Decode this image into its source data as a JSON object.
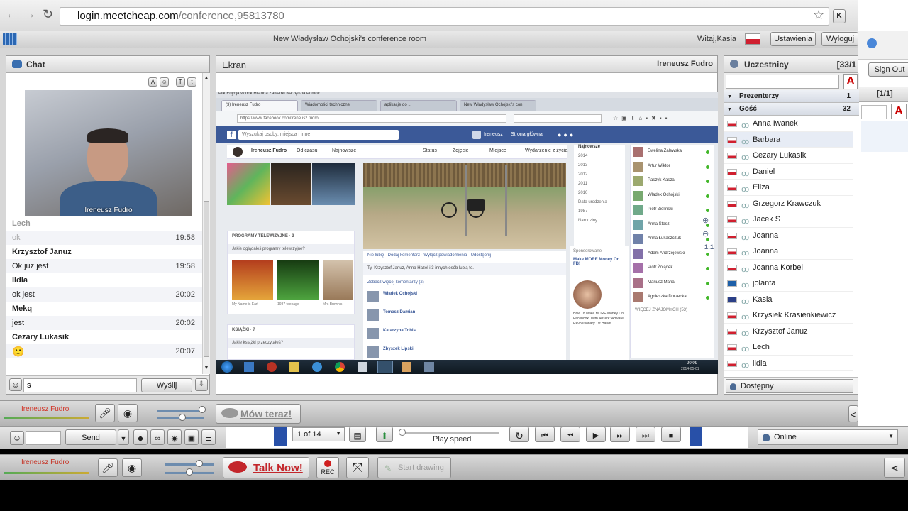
{
  "browser": {
    "url_domain": "login.meetcheap.com",
    "url_path": "/conference,95813780",
    "star_icon": "☆",
    "ext_label": "K"
  },
  "app": {
    "room_title": "New Władysław Ochojski's conference room",
    "greeting": "Witaj,Kasia",
    "settings_button": "Ustawienia",
    "logout_button": "Wyloguj s",
    "outer_signout": "Sign Out",
    "outer_page": "[1/1]"
  },
  "chat": {
    "title": "Chat",
    "video_label": "Ireneusz Fudro",
    "messages": [
      {
        "author": "Lech",
        "text": "ok",
        "time": "19:58",
        "faded": true
      },
      {
        "author": "Krzysztof Januz",
        "text": "Ok już jest",
        "time": "19:58"
      },
      {
        "author": "lidia",
        "text": "ok jest",
        "time": "20:02"
      },
      {
        "author": "Mekq",
        "text": "jest",
        "time": "20:02"
      },
      {
        "author": "Cezary Lukasik",
        "text": "🙂",
        "time": "20:07"
      }
    ],
    "input_value": "s",
    "send_button": "Wyślij"
  },
  "screen_panel": {
    "title": "Ekran",
    "presenter": "Ireneusz Fudro",
    "shared": {
      "tabs": [
        "(3) Ireneusz Fudro",
        "Wiadomości techniczne",
        "aplikacje do ..",
        "New Władysław Ochojski's con"
      ],
      "url": "https://www.facebook.com/Ireneusz.fudro",
      "fb_search": "Wyszukaj osoby, miejsca i inne",
      "fb_user": "Ireneusz",
      "fb_home": "Strona główna",
      "profile_name": "Ireneusz Fudro",
      "profile_links": [
        "Od czasu",
        "Najnowsze"
      ],
      "post_actions": [
        "Status",
        "Zdjęcie",
        "Miejsce",
        "Wydarzenie z życia"
      ],
      "years": [
        "Najnowsze",
        "2014",
        "2013",
        "2012",
        "2011",
        "2010",
        "Data urodzenia",
        "1987",
        "Narodziny"
      ],
      "section_tv": "PROGRAMY TELEWIZYJNE · 3",
      "tv_question": "Jakie oglądałeś programy telewizyjne?",
      "tv_items": [
        "My Name is Earl",
        "1987 teenage",
        "Mrs Brown's"
      ],
      "section_books": "KSIĄŻKI · 7",
      "books_question": "Jakie książki przeczytałeś?",
      "post_actions_bar": "Nie lubię · Dodaj komentarz · Wyłącz powiadomienia · Udostępnij",
      "likes_line": "Ty, Krzysztof Januz, Anna Hazel i 3 innych osób lubią to.",
      "more_comments": "Zobacz więcej komentarzy (2)",
      "commenters": [
        "Władek Ochojski",
        "Tomasz Damian",
        "Katarzyna Tobis",
        "Zbyszek Lipski"
      ],
      "sponsored": "Sponsorowane",
      "ad_title": "Make MORE Money On FB!",
      "ad_text": "How To Make MORE Money On Facebook! With Adzerk: Adware. Revolutionary 1st Hand!",
      "friends": [
        "Ewelina Zalewska",
        "Artur Wiktor",
        "Paszyk Kasza",
        "Władek Ochojski",
        "Piotr Zielinski",
        "Anna Stasz",
        "Anna Łukaszczuk",
        "Adam Andrzejewski",
        "Piotr Żołądek",
        "Mariusz Maria",
        "Agnieszka Dorzecka"
      ],
      "more_contacts": "WIĘCEJ ZNAJOMYCH (53)",
      "taskbar_time": "20:09",
      "taskbar_date": "2014-05-01"
    }
  },
  "participants": {
    "title": "Uczestnicy",
    "count": "[33/1",
    "group_presenters": "Prezenterzy",
    "group_presenters_count": "1",
    "group_guests": "Gość",
    "group_guests_count": "32",
    "people": [
      {
        "name": "Anna Iwanek",
        "flag": "pl"
      },
      {
        "name": "Barbara",
        "flag": "pl"
      },
      {
        "name": "Cezary Lukasik",
        "flag": "pl"
      },
      {
        "name": "Daniel",
        "flag": "pl"
      },
      {
        "name": "Eliza",
        "flag": "pl"
      },
      {
        "name": "Grzegorz Krawczuk",
        "flag": "pl"
      },
      {
        "name": "Jacek S",
        "flag": "pl"
      },
      {
        "name": "Joanna",
        "flag": "pl"
      },
      {
        "name": "Joanna",
        "flag": "pl"
      },
      {
        "name": "Joanna Korbel",
        "flag": "pl"
      },
      {
        "name": "jolanta",
        "flag": "se"
      },
      {
        "name": "Kasia",
        "flag": "uk"
      },
      {
        "name": "Krzysiek Krasienkiewicz",
        "flag": "pl"
      },
      {
        "name": "Krzysztof Januz",
        "flag": "pl"
      },
      {
        "name": "Lech",
        "flag": "pl"
      },
      {
        "name": "lidia",
        "flag": "pl"
      }
    ],
    "status": "Dostępny"
  },
  "av_bar": {
    "user": "Ireneusz Fudro",
    "talk_button": "Mów teraz!"
  },
  "outer": {
    "send_button": "Send",
    "page_select": "1 of 14",
    "play_speed": "Play speed",
    "status": "Online",
    "user": "Ireneusz Fudro",
    "talk_button": "Talk Now!",
    "rec_label": "REC",
    "start_label": "Start drawing"
  }
}
